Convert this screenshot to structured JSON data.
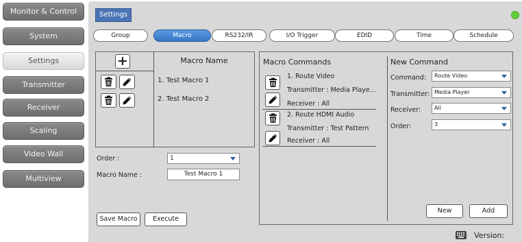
{
  "sidebar": {
    "items": [
      {
        "label": "Monitor & Control",
        "active": false
      },
      {
        "label": "System",
        "active": false
      },
      {
        "label": "Settings",
        "active": true
      },
      {
        "label": "Transmitter",
        "active": false
      },
      {
        "label": "Receiver",
        "active": false
      },
      {
        "label": "Scaling",
        "active": false
      },
      {
        "label": "Video Wall",
        "active": false
      },
      {
        "label": "Multiview",
        "active": false
      }
    ]
  },
  "header": {
    "title": "Settings",
    "status_color": "#63cf3a"
  },
  "tabs": [
    {
      "label": "Group",
      "active": false
    },
    {
      "label": "Macro",
      "active": true
    },
    {
      "label": "RS232/IR",
      "active": false
    },
    {
      "label": "I/O Trigger",
      "active": false
    },
    {
      "label": "EDID",
      "active": false
    },
    {
      "label": "Time",
      "active": false
    },
    {
      "label": "Schedule",
      "active": false
    }
  ],
  "macro_list": {
    "header": "Macro Name",
    "add_icon": "plus-icon",
    "items": [
      {
        "name": "1. Test Macro 1"
      },
      {
        "name": "2. Test Macro 2"
      }
    ]
  },
  "macro_form": {
    "order_label": "Order :",
    "order_value": "1",
    "name_label": "Macro Name :",
    "name_value": "Test Macro 1",
    "save_label": "Save Macro",
    "execute_label": "Execute"
  },
  "commands": {
    "heading": "Macro Commands",
    "items": [
      {
        "title": "1. Route Video",
        "transmitter": "Transmitter : Media Playe...",
        "receiver": "Receiver : All"
      },
      {
        "title": "2. Route HDMI Audio",
        "transmitter": "Transmitter : Test Pattern",
        "receiver": "Receiver : All"
      }
    ]
  },
  "new_command": {
    "heading": "New Command",
    "command_label": "Command:",
    "command_value": "Route Video",
    "transmitter_label": "Transmitter:",
    "transmitter_value": "Media Player",
    "receiver_label": "Receiver:",
    "receiver_value": "All",
    "order_label": "Order:",
    "order_value": "3",
    "new_label": "New",
    "add_label": "Add"
  },
  "footer": {
    "version_label": "Version:"
  },
  "colors": {
    "accent": "#4a74b4",
    "tab_active": "#3576c6",
    "sidebar_button": "#7a7a7a",
    "panel_bg": "#d8d8d8"
  }
}
